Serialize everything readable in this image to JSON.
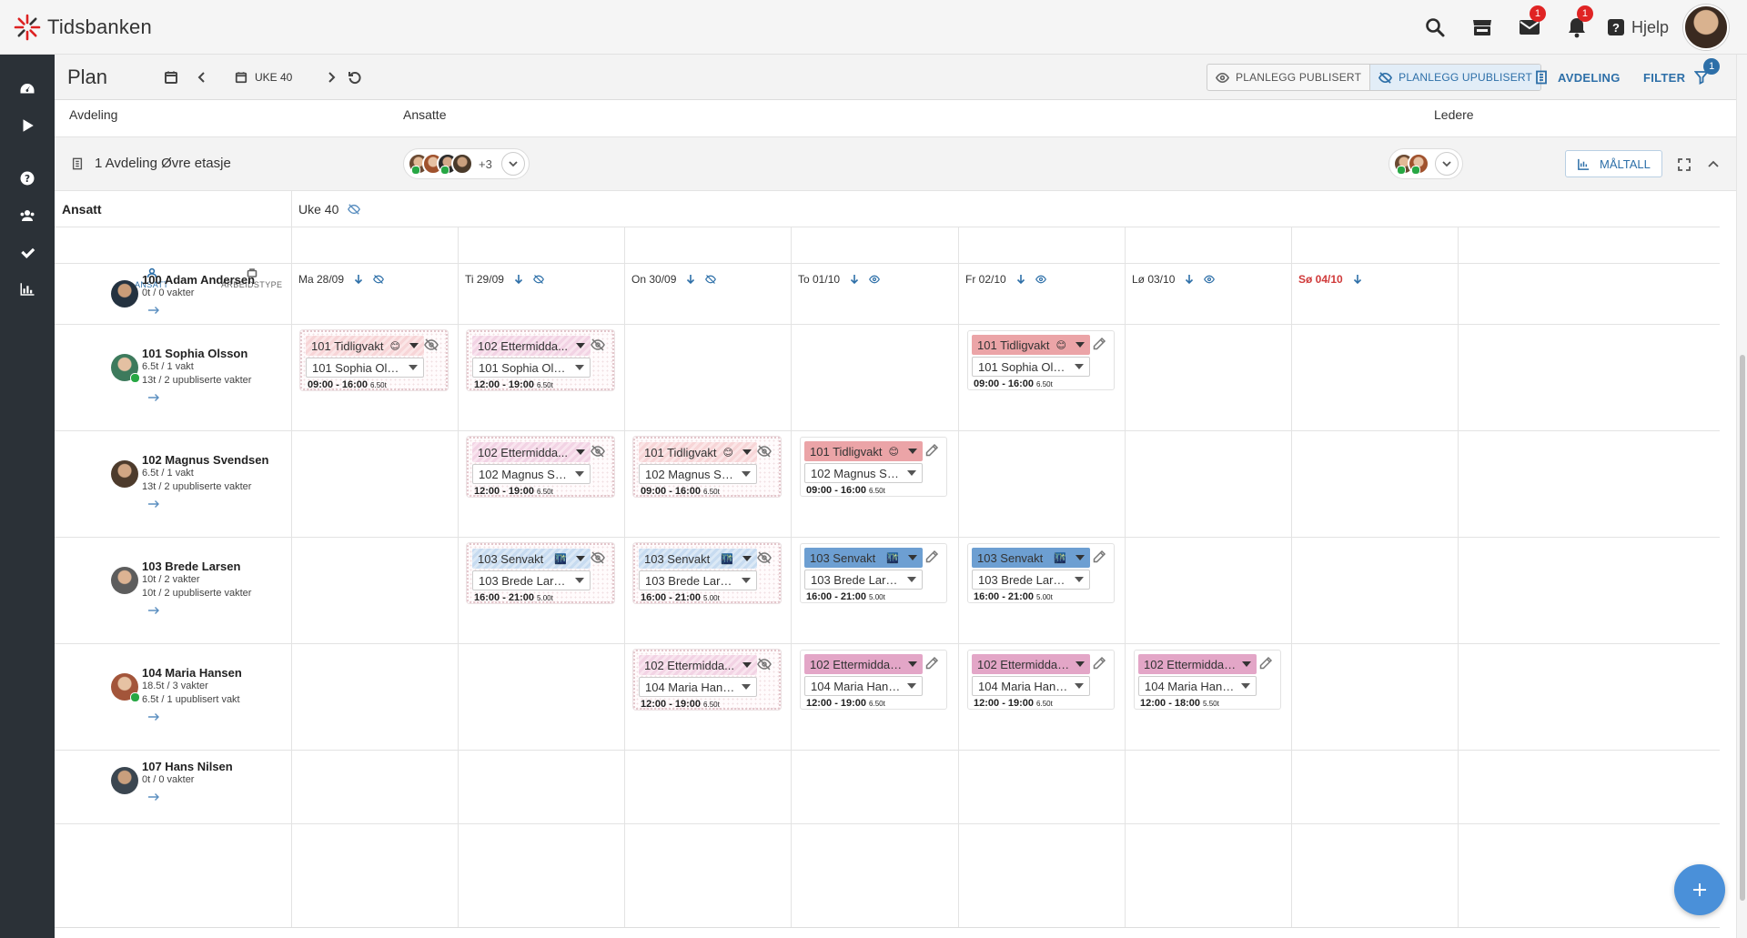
{
  "app": {
    "brand": "Tidsbanken",
    "help_label": "Hjelp",
    "mail_count": "1",
    "notif_count": "1"
  },
  "plan": {
    "title": "Plan",
    "week_label": "UKE 40",
    "planlegg_publisert": "PLANLEGG PUBLISERT",
    "planlegg_upublisert": "PLANLEGG UPUBLISERT",
    "avdeling_link": "AVDELING",
    "filter_link": "FILTER",
    "filter_count": "1"
  },
  "filters": {
    "avdeling": "Avdeling",
    "ansatte": "Ansatte",
    "ledere": "Ledere"
  },
  "dept": {
    "name": "1 Avdeling Øvre etasje",
    "extra_count": "+3",
    "maltall": "MÅLTALL"
  },
  "grid": {
    "ansatt_header": "Ansatt",
    "week_header": "Uke 40",
    "sort_ansatt": "ANSATT",
    "sort_arbeidstype": "ARBEIDSTYPE",
    "days": [
      {
        "label": "Ma 28/09",
        "visibility": "hidden"
      },
      {
        "label": "Ti 29/09",
        "visibility": "hidden"
      },
      {
        "label": "On 30/09",
        "visibility": "hidden"
      },
      {
        "label": "To 01/10",
        "visibility": "visible"
      },
      {
        "label": "Fr 02/10",
        "visibility": "visible"
      },
      {
        "label": "Lø 03/10",
        "visibility": "visible"
      },
      {
        "label": "Sø 04/10",
        "visibility": "none"
      }
    ]
  },
  "employees": [
    {
      "name": "100 Adam Andersen",
      "line1": "0t / 0 vakter",
      "line2": "",
      "online": false
    },
    {
      "name": "101 Sophia Olsson",
      "line1": "6.5t / 1 vakt",
      "line2": "13t / 2 upubliserte vakter",
      "online": true
    },
    {
      "name": "102 Magnus Svendsen",
      "line1": "6.5t / 1 vakt",
      "line2": "13t / 2 upubliserte vakter",
      "online": false
    },
    {
      "name": "103 Brede Larsen",
      "line1": "10t / 2 vakter",
      "line2": "10t / 2 upubliserte vakter",
      "online": false
    },
    {
      "name": "104 Maria Hansen",
      "line1": "18.5t / 3 vakter",
      "line2": "6.5t / 1 upublisert vakt",
      "online": true
    },
    {
      "name": "107 Hans Nilsen",
      "line1": "0t / 0 vakter",
      "line2": "",
      "online": false
    }
  ],
  "shifts": [
    {
      "row": 1,
      "day": 0,
      "status": "unpublished",
      "color": "red",
      "type": "101 Tidligvakt",
      "emoji": "😊",
      "employee": "101 Sophia Olss...",
      "time": "09:00 - 16:00",
      "hours": "6.50t"
    },
    {
      "row": 1,
      "day": 1,
      "status": "unpublished",
      "color": "pink",
      "type": "102 Ettermidda...",
      "emoji": "",
      "employee": "101 Sophia Olss...",
      "time": "12:00 - 19:00",
      "hours": "6.50t"
    },
    {
      "row": 1,
      "day": 4,
      "status": "published",
      "color": "red",
      "type": "101 Tidligvakt",
      "emoji": "😊",
      "employee": "101 Sophia Olsson",
      "time": "09:00 - 16:00",
      "hours": "6.50t"
    },
    {
      "row": 2,
      "day": 1,
      "status": "unpublished",
      "color": "pink",
      "type": "102 Ettermidda...",
      "emoji": "",
      "employee": "102 Magnus Sve...",
      "time": "12:00 - 19:00",
      "hours": "6.50t"
    },
    {
      "row": 2,
      "day": 2,
      "status": "unpublished",
      "color": "red",
      "type": "101 Tidligvakt",
      "emoji": "😊",
      "employee": "102 Magnus Sve...",
      "time": "09:00 - 16:00",
      "hours": "6.50t"
    },
    {
      "row": 2,
      "day": 3,
      "status": "published",
      "color": "red",
      "type": "101 Tidligvakt",
      "emoji": "😊",
      "employee": "102 Magnus Sven...",
      "time": "09:00 - 16:00",
      "hours": "6.50t"
    },
    {
      "row": 3,
      "day": 1,
      "status": "unpublished",
      "color": "blue",
      "type": "103 Senvakt",
      "emoji": "🌃",
      "employee": "103 Brede Larsen",
      "time": "16:00 - 21:00",
      "hours": "5.00t"
    },
    {
      "row": 3,
      "day": 2,
      "status": "unpublished",
      "color": "blue",
      "type": "103 Senvakt",
      "emoji": "🌃",
      "employee": "103 Brede Larsen",
      "time": "16:00 - 21:00",
      "hours": "5.00t"
    },
    {
      "row": 3,
      "day": 3,
      "status": "published",
      "color": "blue",
      "type": "103 Senvakt",
      "emoji": "🌃",
      "employee": "103 Brede Larsen",
      "time": "16:00 - 21:00",
      "hours": "5.00t"
    },
    {
      "row": 3,
      "day": 4,
      "status": "published",
      "color": "blue",
      "type": "103 Senvakt",
      "emoji": "🌃",
      "employee": "103 Brede Larsen",
      "time": "16:00 - 21:00",
      "hours": "5.00t"
    },
    {
      "row": 4,
      "day": 2,
      "status": "unpublished",
      "color": "pink",
      "type": "102 Ettermidda...",
      "emoji": "",
      "employee": "104 Maria Hansen",
      "time": "12:00 - 19:00",
      "hours": "6.50t"
    },
    {
      "row": 4,
      "day": 3,
      "status": "published",
      "color": "pink",
      "type": "102 Ettermiddag...",
      "emoji": "",
      "employee": "104 Maria Hansen",
      "time": "12:00 - 19:00",
      "hours": "6.50t"
    },
    {
      "row": 4,
      "day": 4,
      "status": "published",
      "color": "pink",
      "type": "102 Ettermiddag...",
      "emoji": "",
      "employee": "104 Maria Hansen",
      "time": "12:00 - 19:00",
      "hours": "6.50t"
    },
    {
      "row": 4,
      "day": 5,
      "status": "published",
      "color": "pink",
      "type": "102 Ettermiddag...",
      "emoji": "",
      "employee": "104 Maria Hansen",
      "time": "12:00 - 18:00",
      "hours": "5.50t"
    }
  ],
  "colors": {
    "brand_red": "#e02424",
    "accent_blue": "#2d6fa8",
    "sidebar_bg": "#2b3137",
    "online_green": "#27a744"
  }
}
